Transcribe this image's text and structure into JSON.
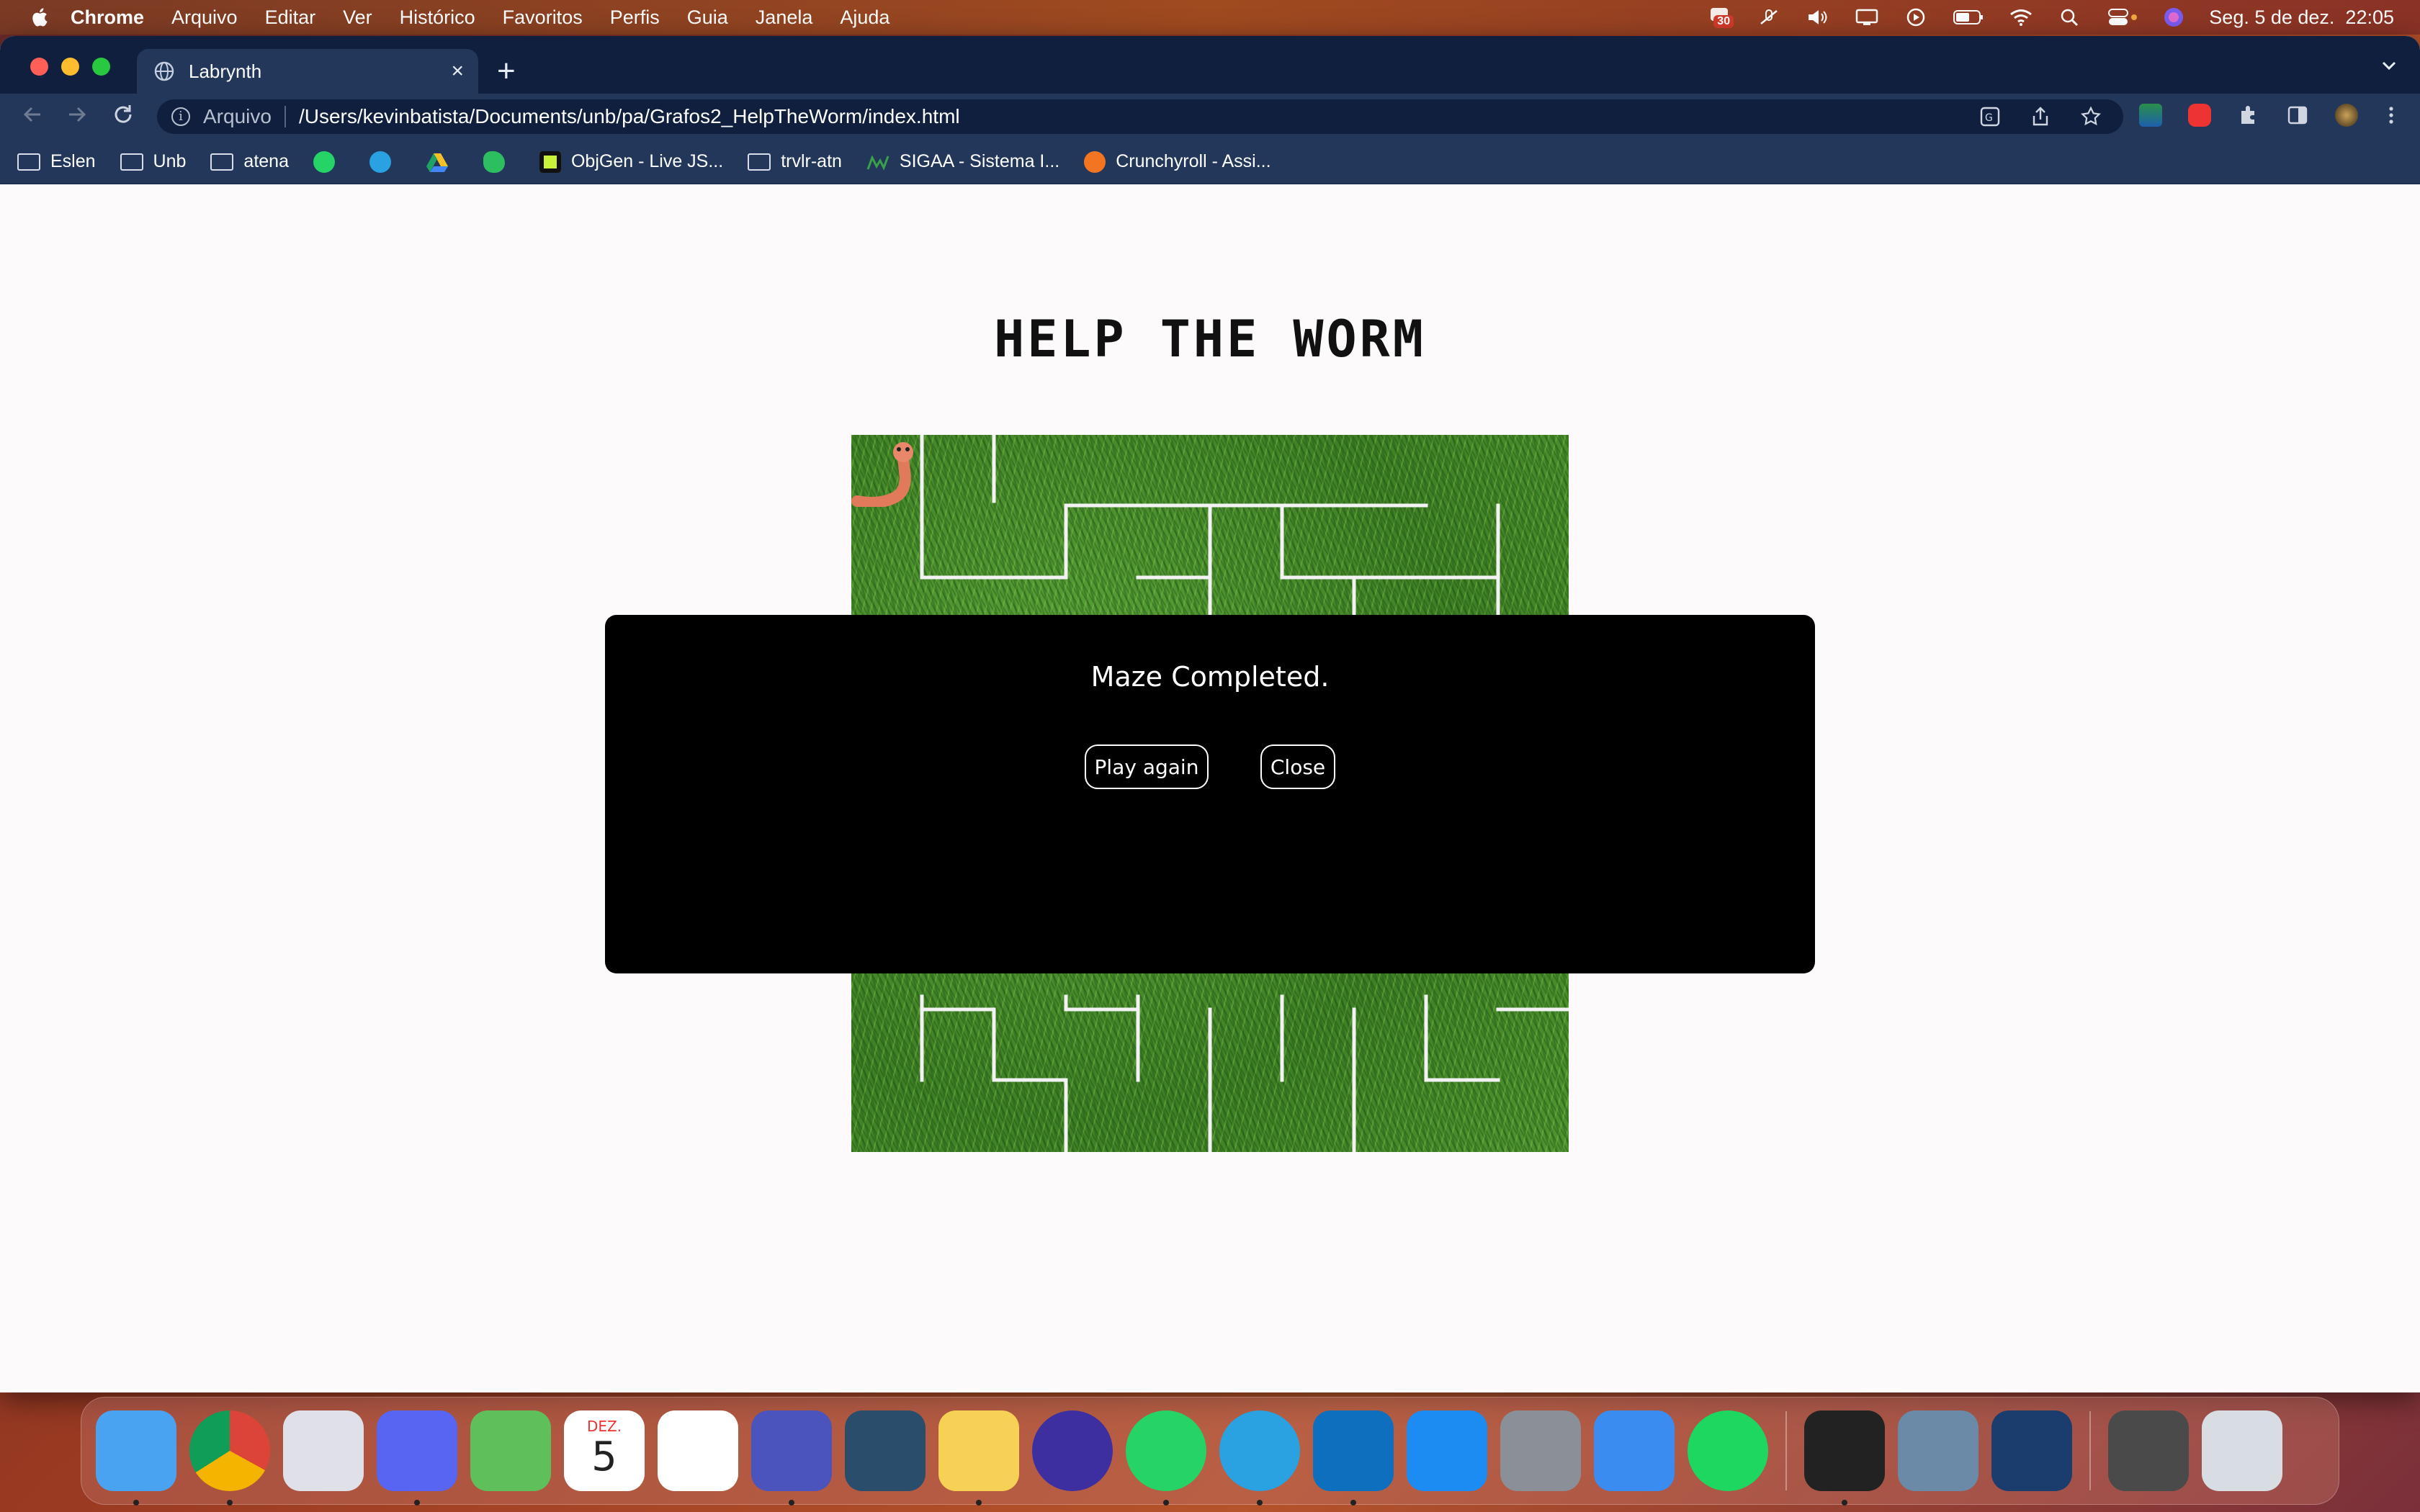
{
  "menubar": {
    "app": "Chrome",
    "items": [
      "Arquivo",
      "Editar",
      "Ver",
      "Histórico",
      "Favoritos",
      "Perfis",
      "Guia",
      "Janela",
      "Ajuda"
    ],
    "badge": "30",
    "datetime": "Seg. 5 de dez.  22:05"
  },
  "browser": {
    "tab_title": "Labrynth",
    "address_scheme": "Arquivo",
    "address_url": "/Users/kevinbatista/Documents/unb/pa/Grafos2_HelpTheWorm/index.html",
    "bookmarks": [
      "Eslen",
      "Unb",
      "atena",
      "ObjGen - Live JS...",
      "trvlr-atn",
      "SIGAA - Sistema I...",
      "Crunchyroll - Assi..."
    ]
  },
  "page": {
    "title": "HELP THE WORM"
  },
  "modal": {
    "message": "Maze Completed.",
    "play_again": "Play again",
    "close": "Close"
  },
  "dock": {
    "apps": [
      "finder",
      "chrome",
      "launchpad",
      "discord",
      "maps",
      "calendar",
      "reminders",
      "teams",
      "mysql-workbench",
      "notes",
      "lens",
      "whatsapp",
      "telegram",
      "vscode",
      "app-store",
      "system-preferences",
      "mail",
      "spotify",
      "terminal",
      "preview",
      "quicktime",
      "downloads",
      "trash"
    ],
    "calendar_month": "DEZ.",
    "calendar_day": "5",
    "colors": [
      "#4aa3f0",
      "#ffffff",
      "#e0e0e8",
      "#5865f2",
      "#5fbf5a",
      "#ffffff",
      "#ffffff",
      "#4b53bc",
      "#2a4d6b",
      "#f6d155",
      "#3d2fa0",
      "#25d366",
      "#2aa1e0",
      "#0f6fbf",
      "#1c8cf2",
      "#8a8f98",
      "#3a8cf0",
      "#1ed760",
      "#222222",
      "#6a8aa8",
      "#1b3d6d",
      "#4a4a4a",
      "#d8dde3"
    ]
  }
}
